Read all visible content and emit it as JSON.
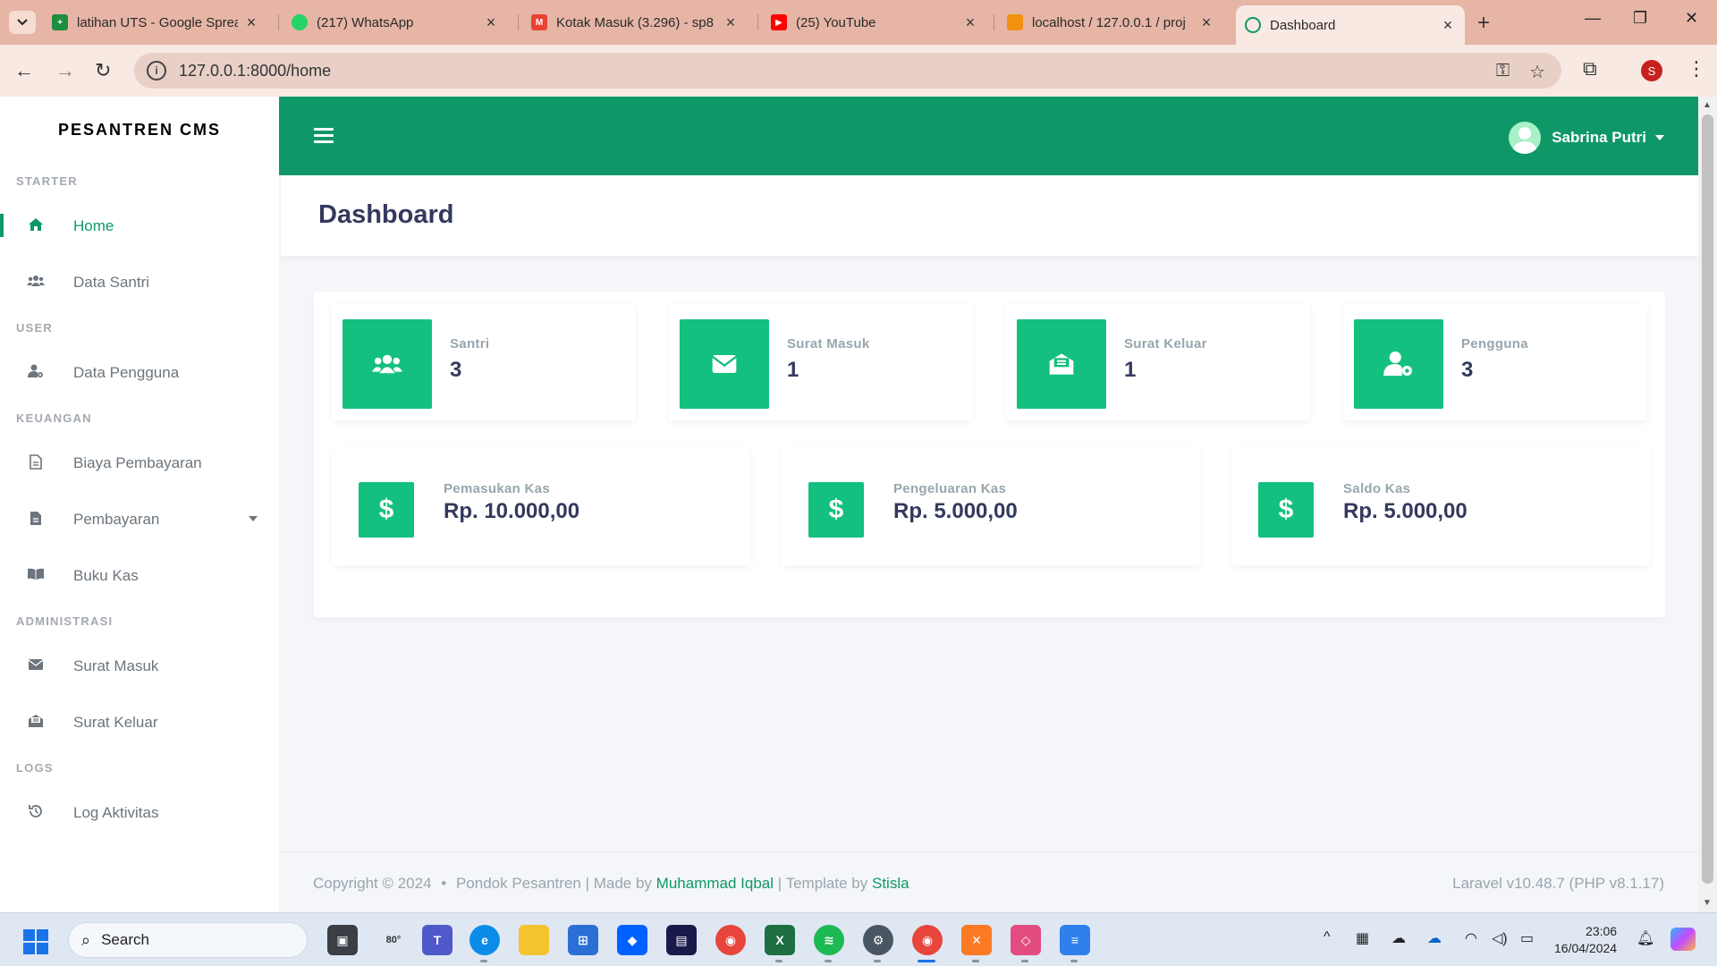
{
  "browser": {
    "tabs": [
      {
        "title": "latihan UTS - Google Sprea",
        "icon": "google-sheets-icon",
        "color": "#1e8e3e"
      },
      {
        "title": "(217) WhatsApp",
        "icon": "whatsapp-icon",
        "color": "#25d366"
      },
      {
        "title": "Kotak Masuk (3.296) - sp8",
        "icon": "gmail-icon",
        "color": "#ea4335"
      },
      {
        "title": "(25) YouTube",
        "icon": "youtube-icon",
        "color": "#ff0000"
      },
      {
        "title": "localhost / 127.0.0.1 / proj",
        "icon": "phpmyadmin-icon",
        "color": "#f29111"
      },
      {
        "title": "Dashboard",
        "icon": "loading-icon",
        "color": "#0e9867"
      }
    ],
    "url": "127.0.0.1:8000/home",
    "profile_initial": "S"
  },
  "sidebar": {
    "brand": "PESANTREN CMS",
    "sections": {
      "starter": "STARTER",
      "user": "USER",
      "keuangan": "KEUANGAN",
      "administrasi": "ADMINISTRASI",
      "logs": "LOGS"
    },
    "items": {
      "home": "Home",
      "data_santri": "Data Santri",
      "data_pengguna": "Data Pengguna",
      "biaya_pembayaran": "Biaya Pembayaran",
      "pembayaran": "Pembayaran",
      "buku_kas": "Buku Kas",
      "surat_masuk": "Surat Masuk",
      "surat_keluar": "Surat Keluar",
      "log_aktivitas": "Log Aktivitas"
    }
  },
  "topnav": {
    "user_name": "Sabrina Putri"
  },
  "page": {
    "title": "Dashboard"
  },
  "stats": [
    {
      "label": "Santri",
      "value": "3",
      "icon": "users-icon"
    },
    {
      "label": "Surat Masuk",
      "value": "1",
      "icon": "envelope-icon"
    },
    {
      "label": "Surat Keluar",
      "value": "1",
      "icon": "envelope-open-icon"
    },
    {
      "label": "Pengguna",
      "value": "3",
      "icon": "user-cog-icon"
    }
  ],
  "kas": [
    {
      "label": "Pemasukan Kas",
      "value": "Rp. 10.000,00",
      "icon": "dollar-icon"
    },
    {
      "label": "Pengeluaran Kas",
      "value": "Rp. 5.000,00",
      "icon": "dollar-icon"
    },
    {
      "label": "Saldo Kas",
      "value": "Rp. 5.000,00",
      "icon": "dollar-icon"
    }
  ],
  "kas_symbol": "$",
  "footer": {
    "copyright": "Copyright © 2024",
    "bullet": "•",
    "org": "Pondok Pesantren",
    "made_by_prefix": "| Made by",
    "author": "Muhammad Iqbal",
    "template_prefix": "| Template by",
    "template": "Stisla",
    "version": "Laravel v10.48.7 (PHP v8.1.17)"
  },
  "taskbar": {
    "search_label": "Search",
    "weather": "80°",
    "time": "23:06",
    "date": "16/04/2024"
  },
  "colors": {
    "primary": "#0e9867",
    "accent": "#13c07f"
  }
}
